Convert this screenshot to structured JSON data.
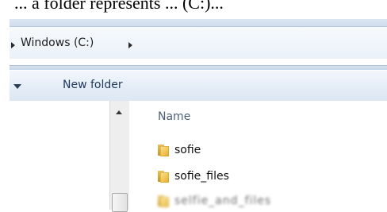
{
  "top_caption": "... a folder represents ... (C:)...",
  "address_bar": {
    "location": "Windows (C:)"
  },
  "toolbar": {
    "new_folder_label": "New folder"
  },
  "file_list": {
    "column_name": "Name",
    "items": [
      {
        "name": "sofie",
        "icon": "folder-icon"
      },
      {
        "name": "sofie_files",
        "icon": "folder-icon"
      },
      {
        "name": "selfie_and_files",
        "icon": "folder-icon",
        "obscured": true
      }
    ]
  },
  "colors": {
    "toolbar_text": "#1e395b",
    "header_text": "#4c607a",
    "folder_yellow": "#f0c44d"
  }
}
